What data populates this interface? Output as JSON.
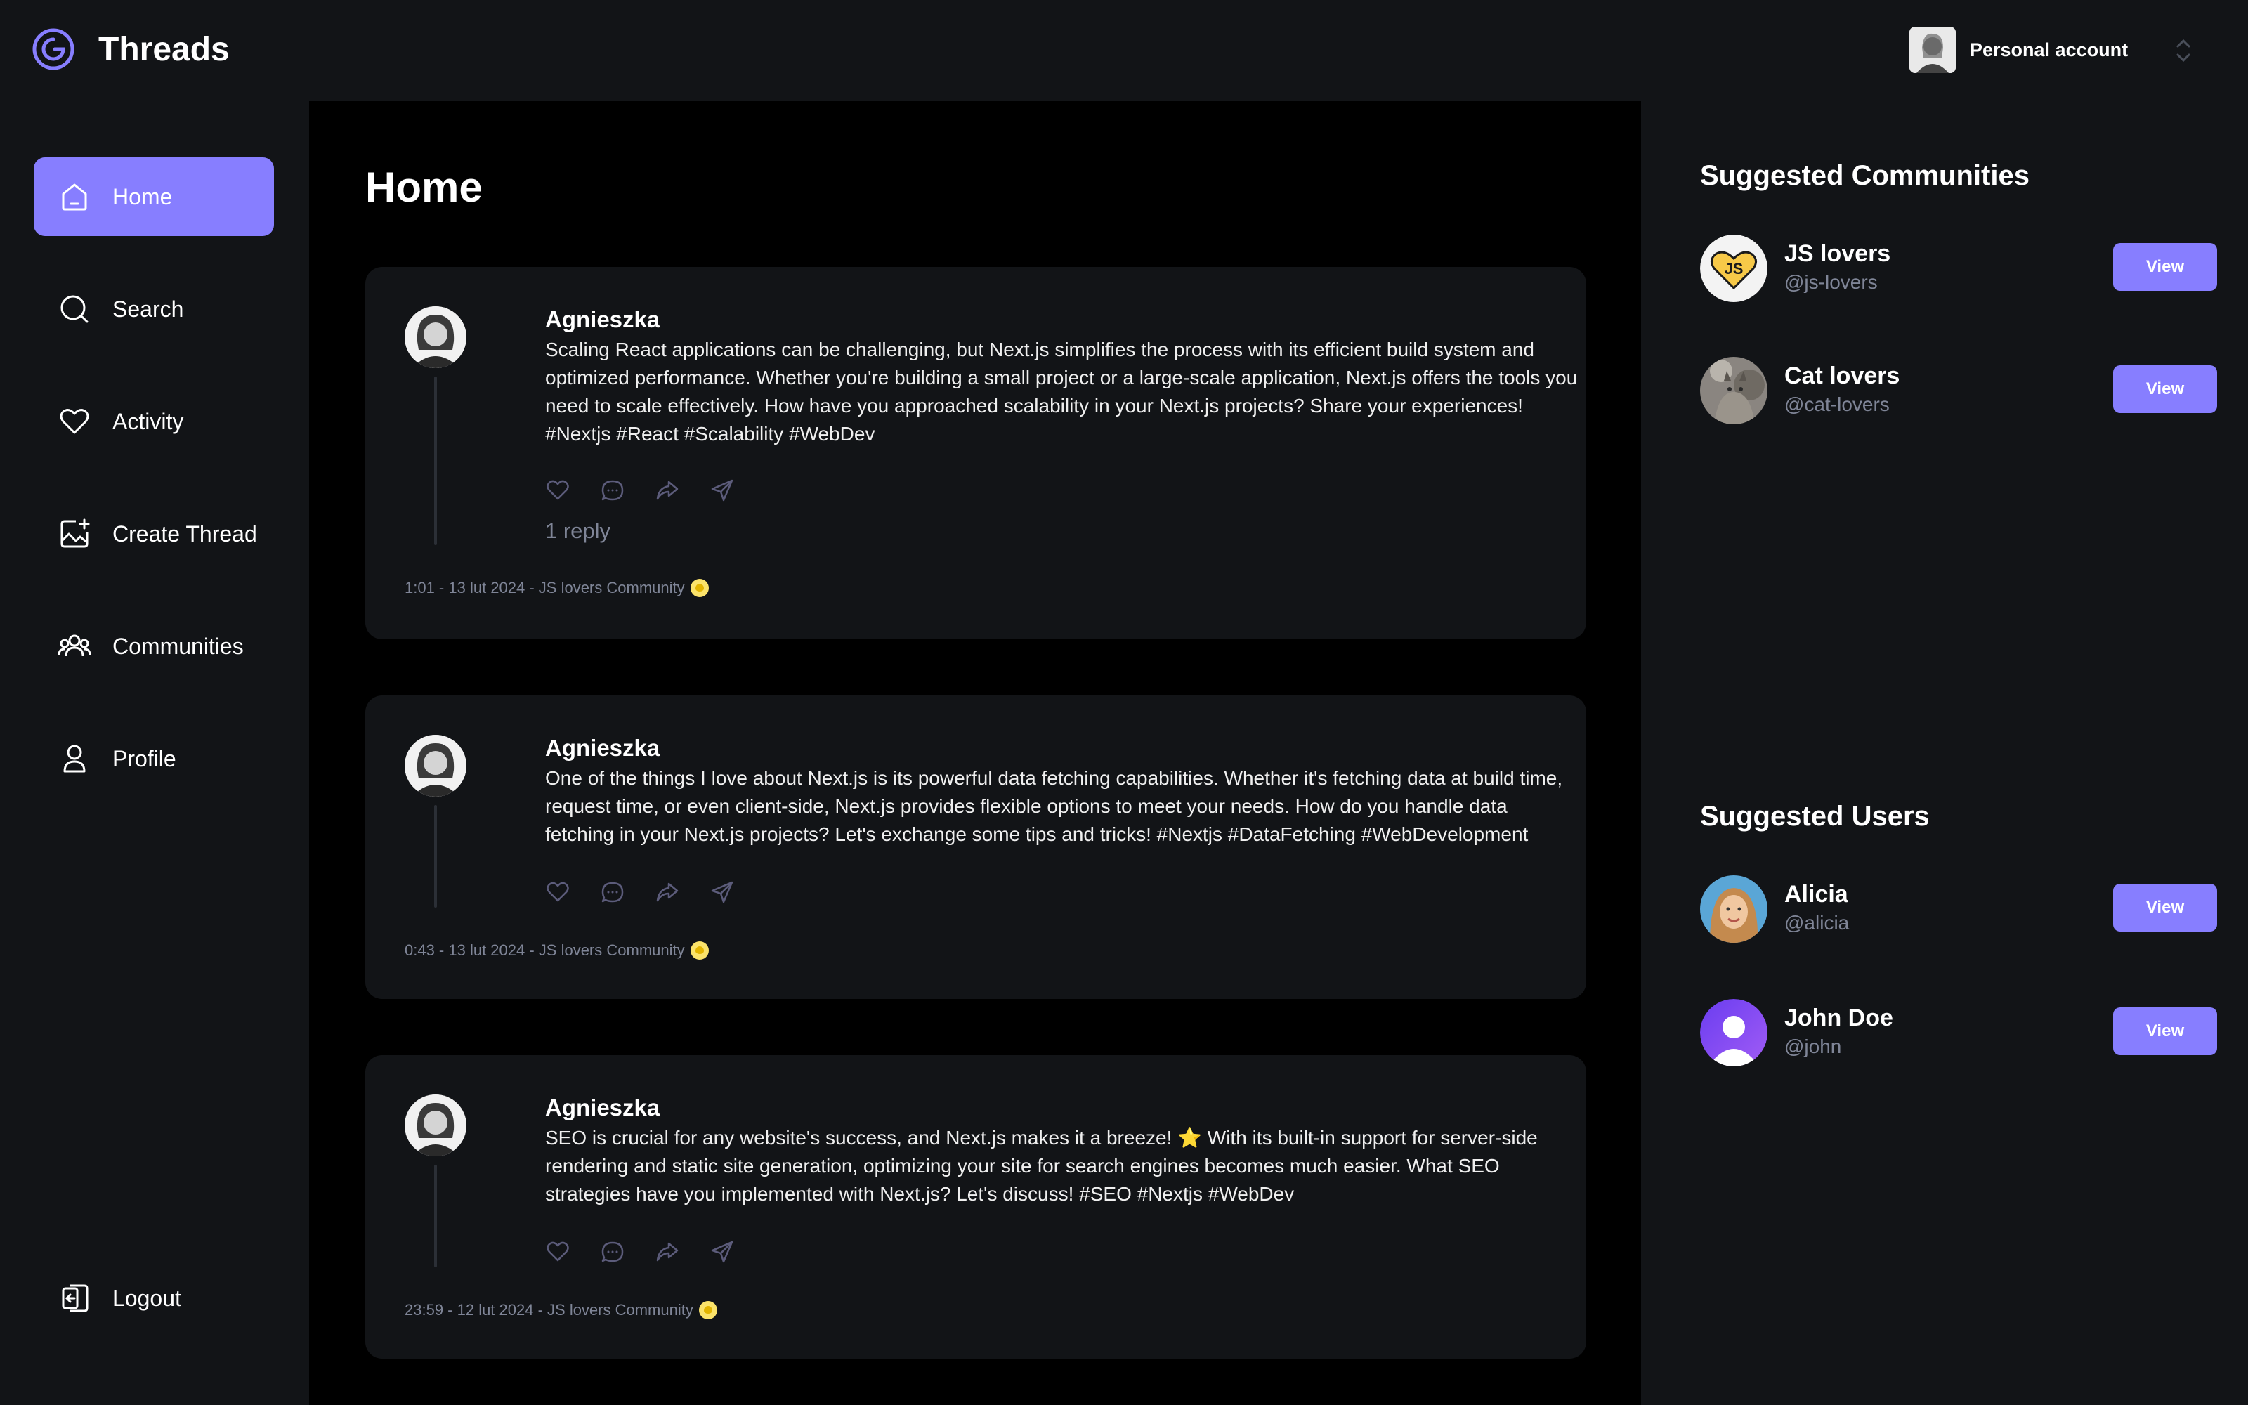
{
  "app": {
    "name": "Threads"
  },
  "account": {
    "label": "Personal account"
  },
  "nav": {
    "items": [
      {
        "label": "Home",
        "icon": "home-icon"
      },
      {
        "label": "Search",
        "icon": "search-icon"
      },
      {
        "label": "Activity",
        "icon": "heart-icon"
      },
      {
        "label": "Create Thread",
        "icon": "image-plus-icon"
      },
      {
        "label": "Communities",
        "icon": "users-icon"
      },
      {
        "label": "Profile",
        "icon": "user-icon"
      }
    ],
    "logout": {
      "label": "Logout",
      "icon": "logout-icon"
    }
  },
  "main": {
    "title": "Home",
    "threads": [
      {
        "author": "Agnieszka",
        "content": "Scaling React applications can be challenging, but Next.js simplifies the process with its efficient build system and optimized performance. Whether you're building a small project or a large-scale application, Next.js offers the tools you need to scale effectively. How have you approached scalability in your Next.js projects? Share your experiences! #Nextjs #React #Scalability #WebDev",
        "reply": "1 reply",
        "meta": "1:01 - 13 lut 2024 - JS lovers Community"
      },
      {
        "author": "Agnieszka",
        "content": "One of the things I love about Next.js is its powerful data fetching capabilities. Whether it's fetching data at build time, request time, or even client-side, Next.js provides flexible options to meet your needs. How do you handle data fetching in your Next.js projects? Let's exchange some tips and tricks! #Nextjs #DataFetching #WebDevelopment",
        "reply": "",
        "meta": "0:43 - 13 lut 2024 - JS lovers Community"
      },
      {
        "author": "Agnieszka",
        "content": "SEO is crucial for any website's success, and Next.js makes it a breeze! ⭐ With its built-in support for server-side rendering and static site generation, optimizing your site for search engines becomes much easier. What SEO strategies have you implemented with Next.js? Let's discuss! #SEO #Nextjs #WebDev",
        "reply": "",
        "meta": "23:59 - 12 lut 2024 - JS lovers Community"
      }
    ]
  },
  "right": {
    "communities_title": "Suggested Communities",
    "communities": [
      {
        "name": "JS lovers",
        "handle": "@js-lovers",
        "button": "View",
        "badge": "JS"
      },
      {
        "name": "Cat lovers",
        "handle": "@cat-lovers",
        "button": "View"
      }
    ],
    "users_title": "Suggested Users",
    "users": [
      {
        "name": "Alicia",
        "handle": "@alicia",
        "button": "View"
      },
      {
        "name": "John Doe",
        "handle": "@john",
        "button": "View"
      }
    ]
  },
  "colors": {
    "accent": "#877EFF",
    "bg": "#121417",
    "main_bg": "#000000",
    "muted": "#7f8597"
  }
}
